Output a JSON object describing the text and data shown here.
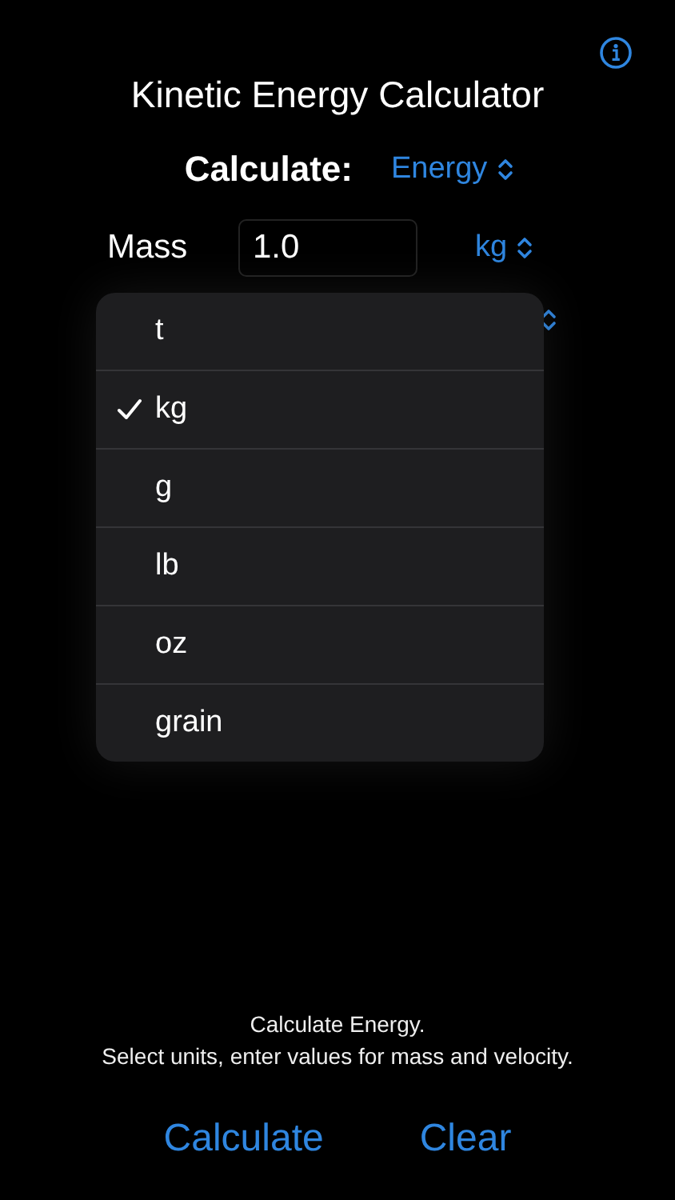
{
  "info_button": {
    "kind": "info"
  },
  "title": "Kinetic Energy Calculator",
  "calculate_row": {
    "label": "Calculate:",
    "value": "Energy"
  },
  "mass_row": {
    "label": "Mass",
    "value": "1.0",
    "unit": "kg"
  },
  "velocity_row": {
    "kind": "unit_picker"
  },
  "unit_menu": [
    {
      "label": "t",
      "selected": false
    },
    {
      "label": "kg",
      "selected": true
    },
    {
      "label": "g",
      "selected": false
    },
    {
      "label": "lb",
      "selected": false
    },
    {
      "label": "oz",
      "selected": false
    },
    {
      "label": "grain",
      "selected": false
    }
  ],
  "instructions": [
    "Calculate Energy.",
    "Select units, enter values for mass and velocity."
  ],
  "buttons": [
    "Calculate",
    "Clear"
  ]
}
